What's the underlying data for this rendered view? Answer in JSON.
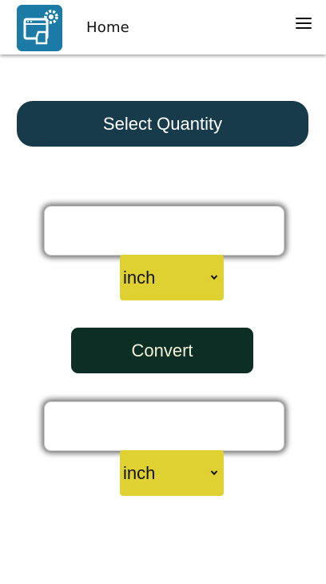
{
  "header": {
    "title": "Home",
    "logo_icon": "converter-app-logo-icon",
    "menu_icon": "hamburger-menu-icon"
  },
  "colors": {
    "header_bg": "#ffffff",
    "select_quantity_bg": "#173b4a",
    "convert_bg": "#0c2e24",
    "unit_select_bg": "#e0d133",
    "logo_bg": "#1b7ba6"
  },
  "main": {
    "select_quantity_label": "Select Quantity",
    "from": {
      "value": "",
      "unit": "inch"
    },
    "convert_label": "Convert",
    "to": {
      "value": "",
      "unit": "inch"
    }
  }
}
